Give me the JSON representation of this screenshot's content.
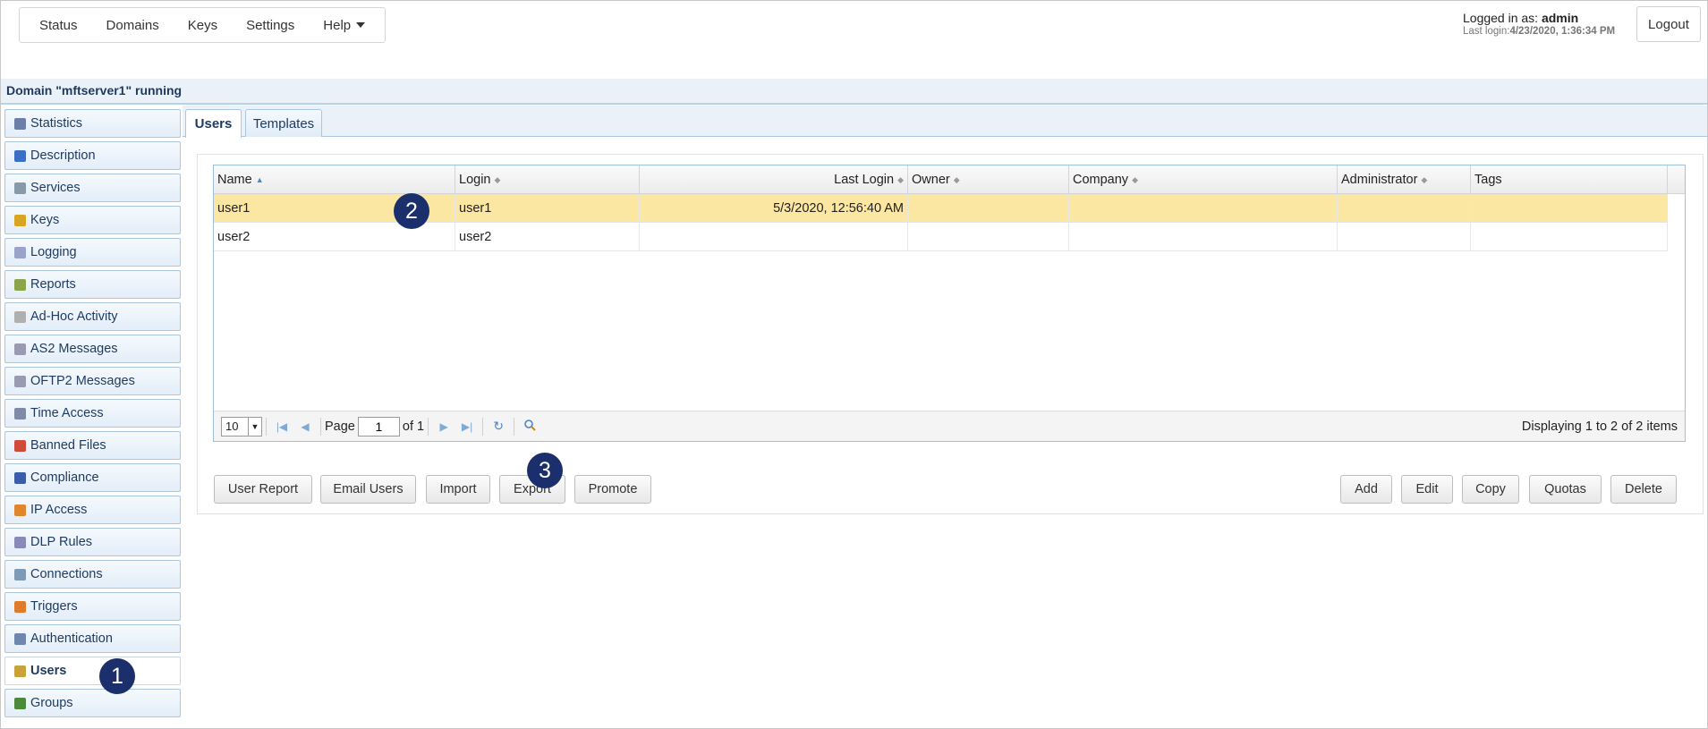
{
  "nav": {
    "items": [
      "Status",
      "Domains",
      "Keys",
      "Settings",
      "Help"
    ]
  },
  "user": {
    "logged_in_prefix": "Logged in as: ",
    "name": "admin",
    "last_login_prefix": "Last login:",
    "last_login_value": "4/23/2020, 1:36:34 PM",
    "logout_label": "Logout"
  },
  "domain_status": "Domain \"mftserver1\" running",
  "sidebar": {
    "items": [
      {
        "label": "Statistics",
        "icon": "statistics-icon",
        "color": "#6b7fa8"
      },
      {
        "label": "Description",
        "icon": "description-icon",
        "color": "#3a6fc4"
      },
      {
        "label": "Services",
        "icon": "services-icon",
        "color": "#8899aa"
      },
      {
        "label": "Keys",
        "icon": "keys-icon",
        "color": "#d8a623"
      },
      {
        "label": "Logging",
        "icon": "logging-icon",
        "color": "#9aa3c9"
      },
      {
        "label": "Reports",
        "icon": "reports-icon",
        "color": "#8aa54a"
      },
      {
        "label": "Ad-Hoc Activity",
        "icon": "adhoc-icon",
        "color": "#b0b0b0"
      },
      {
        "label": "AS2 Messages",
        "icon": "as2-icon",
        "color": "#9a9ab0"
      },
      {
        "label": "OFTP2 Messages",
        "icon": "oftp2-icon",
        "color": "#9a9ab0"
      },
      {
        "label": "Time Access",
        "icon": "time-access-icon",
        "color": "#7f8ba6"
      },
      {
        "label": "Banned Files",
        "icon": "banned-files-icon",
        "color": "#d04a3a"
      },
      {
        "label": "Compliance",
        "icon": "compliance-icon",
        "color": "#3a5ea8"
      },
      {
        "label": "IP Access",
        "icon": "ip-access-icon",
        "color": "#e0862c"
      },
      {
        "label": "DLP Rules",
        "icon": "dlp-icon",
        "color": "#8a8ab8"
      },
      {
        "label": "Connections",
        "icon": "connections-icon",
        "color": "#7f9ab4"
      },
      {
        "label": "Triggers",
        "icon": "triggers-icon",
        "color": "#e07b2c"
      },
      {
        "label": "Authentication",
        "icon": "authentication-icon",
        "color": "#6f86ae"
      },
      {
        "label": "Users",
        "icon": "users-icon",
        "color": "#c9a23a"
      },
      {
        "label": "Groups",
        "icon": "groups-icon",
        "color": "#4a8a3a"
      }
    ]
  },
  "tabs": [
    "Users",
    "Templates"
  ],
  "table": {
    "columns": [
      "Name",
      "Login",
      "Last Login",
      "Owner",
      "Company",
      "Administrator",
      "Tags"
    ],
    "rows": [
      {
        "name": "user1",
        "login": "user1",
        "last_login": "5/3/2020, 12:56:40 AM",
        "owner": "",
        "company": "",
        "administrator": "",
        "tags": ""
      },
      {
        "name": "user2",
        "login": "user2",
        "last_login": "",
        "owner": "",
        "company": "",
        "administrator": "",
        "tags": ""
      }
    ]
  },
  "pager": {
    "page_size": "10",
    "page_label": "Page",
    "page": "1",
    "of_label": "of 1",
    "display": "Displaying 1 to 2 of 2 items"
  },
  "actions": {
    "left": [
      "User Report",
      "Email Users",
      "Import",
      "Export",
      "Promote"
    ],
    "right": [
      "Add",
      "Edit",
      "Copy",
      "Quotas",
      "Delete"
    ]
  },
  "badges": [
    "1",
    "2",
    "3"
  ],
  "colors": {
    "selected_row": "#fbe6a2",
    "badge": "#1a2f6b",
    "accent_border": "#a9c6e3"
  }
}
